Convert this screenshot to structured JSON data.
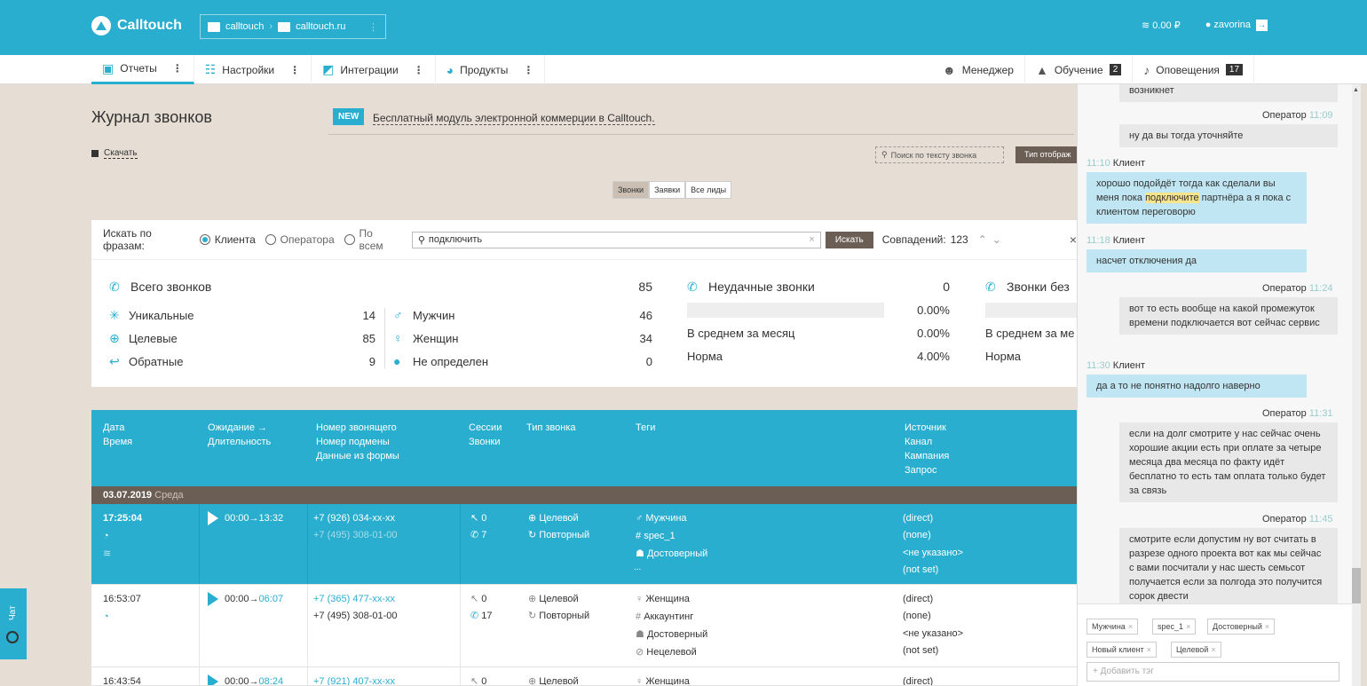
{
  "header": {
    "logo": "Calltouch",
    "account": "calltouch",
    "site": "calltouch.ru",
    "balance": "0.00 ₽",
    "user": "zavorina"
  },
  "nav": {
    "left": [
      "Отчеты",
      "Настройки",
      "Интеграции",
      "Продукты"
    ],
    "manager": "Менеджер",
    "training": "Обучение",
    "training_count": "2",
    "notifications": "Оповещения",
    "notifications_count": "17"
  },
  "page": {
    "title": "Журнал звонков",
    "new_badge": "NEW",
    "promo": "Бесплатный модуль электронной коммерции в Calltouch.",
    "download": "Скачать",
    "text_search": "Поиск по тексту звонка",
    "type_button": "Тип отображ",
    "segments": [
      "Звонки",
      "Заявки",
      "Все лиды"
    ]
  },
  "search": {
    "label": "Искать по фразам:",
    "options": [
      "Клиента",
      "Оператора",
      "По всем"
    ],
    "query": "подключить",
    "button": "Искать",
    "matches": "Совпадений:",
    "matches_count": "123"
  },
  "stats": {
    "total": {
      "title": "Всего звонков",
      "value": "85"
    },
    "left": [
      {
        "label": "Уникальные",
        "value": "14"
      },
      {
        "label": "Целевые",
        "value": "85"
      },
      {
        "label": "Обратные",
        "value": "9"
      }
    ],
    "gender": [
      {
        "label": "Мужчин",
        "value": "46"
      },
      {
        "label": "Женщин",
        "value": "34"
      },
      {
        "label": "Не определен",
        "value": "0"
      }
    ],
    "failed": {
      "title": "Неудачные звонки",
      "value": "0",
      "bar_pct": "0.00%",
      "avg_label": "В среднем за месяц",
      "avg": "0.00%",
      "norm_label": "Норма",
      "norm": "4.00%"
    },
    "third": {
      "title": "Звонки без",
      "avg_label": "В среднем за ме",
      "norm_label": "Норма"
    }
  },
  "table": {
    "headers": {
      "date": [
        "Дата",
        "Время"
      ],
      "wait": [
        "Ожидание →",
        "Длительность"
      ],
      "number": [
        "Номер звонящего",
        "Номер подмены",
        "Данные из формы"
      ],
      "sessions": [
        "Сессии",
        "Звонки"
      ],
      "type": "Тип звонка",
      "tags": "Теги",
      "source": [
        "Источник",
        "Канал",
        "Кампания",
        "Запрос"
      ]
    },
    "date_group": {
      "date": "03.07.2019",
      "dow": "Среда"
    },
    "rows": [
      {
        "time": "17:25:04",
        "wait": "00:00",
        "dur": "13:32",
        "caller": "+7 (926) 034-xx-xx",
        "sub": "+7 (495) 308-01-00",
        "sessions": "0",
        "calls": "7",
        "type1": "Целевой",
        "type2": "Повторный",
        "tags": [
          "Мужчина",
          "spec_1",
          "Достоверный",
          "..."
        ],
        "source": [
          "(direct)",
          "(none)",
          "<не указано>",
          "(not set)"
        ]
      },
      {
        "time": "16:53:07",
        "wait": "00:00",
        "dur": "06:07",
        "caller": "+7 (365) 477-xx-xx",
        "sub": "+7 (495) 308-01-00",
        "sessions": "0",
        "calls": "17",
        "type1": "Целевой",
        "type2": "Повторный",
        "tags": [
          "Женщина",
          "Аккаунтинг",
          "Достоверный",
          "Нецелевой"
        ],
        "source": [
          "(direct)",
          "(none)",
          "<не указано>",
          "(not set)"
        ]
      },
      {
        "time": "16:43:54",
        "wait": "00:00",
        "dur": "08:24",
        "caller": "+7 (921) 407-xx-xx",
        "sessions": "0",
        "type1": "Целевой",
        "tags": [
          "Женщина"
        ],
        "source": [
          "(direct)"
        ]
      }
    ]
  },
  "chat": {
    "top_fragment": "возникнет",
    "operator": "Оператор",
    "client": "Клиент",
    "messages": [
      {
        "who": "op",
        "time": "11:09",
        "text": "ну да вы тогда уточняйте"
      },
      {
        "who": "cl",
        "time": "11:10",
        "text_a": "хорошо подойдёт тогда как сделали вы меня пока ",
        "highlight": "подключите",
        "text_b": " партнёра а я пока с клиентом переговорю"
      },
      {
        "who": "cl",
        "time": "11:18",
        "text": "насчет отключения да"
      },
      {
        "who": "op",
        "time": "11:24",
        "text": "вот то есть вообще на какой промежуток времени подключается вот сейчас сервис"
      },
      {
        "who": "cl",
        "time": "11:30",
        "text": "да а то не понятно надолго наверно"
      },
      {
        "who": "op",
        "time": "11:31",
        "text": "если на долг смотрите у нас сейчас очень хорошие акции есть при оплате за четыре месяца два месяца по факту идёт бесплатно то есть там оплата только будет за связь"
      },
      {
        "who": "op",
        "time": "11:45",
        "text": "смотрите если допустим ну вот считать в разрезе одного проекта вот как мы сейчас с вами посчитали у нас шесть семьсот получается если за полгода это получится сорок двести"
      }
    ],
    "tags": [
      "Мужчина",
      "spec_1",
      "Достоверный",
      "Новый клиент",
      "Целевой"
    ],
    "add_tag": "+ Добавить тэг"
  },
  "chat_tab": "Чат"
}
